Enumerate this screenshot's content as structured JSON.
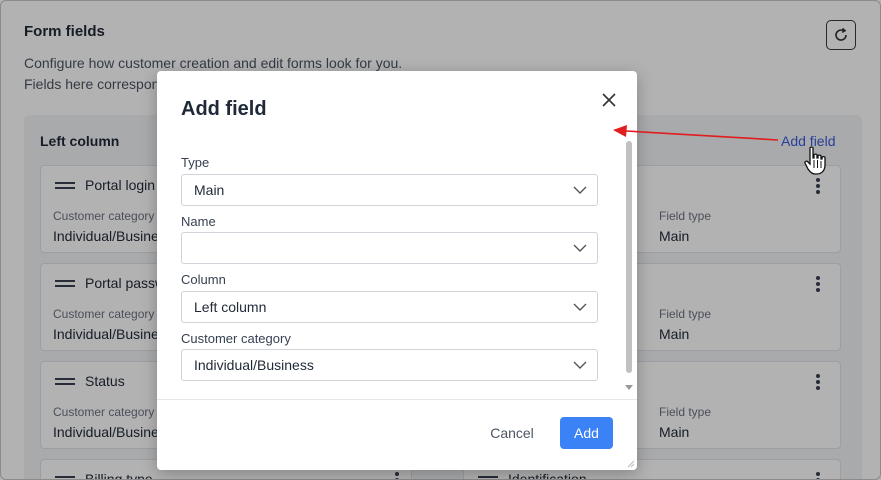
{
  "page": {
    "title": "Form fields",
    "description_line1": "Configure how customer creation and edit forms look for you.",
    "description_line2": "Fields here correspond to the customer fields in your customer profile."
  },
  "left_column": {
    "title": "Left column",
    "cards": [
      {
        "title": "Portal login",
        "category_label": "Customer category",
        "category_value": "Individual/Business"
      },
      {
        "title": "Portal password",
        "category_label": "Customer category",
        "category_value": "Individual/Business"
      },
      {
        "title": "Status",
        "category_label": "Customer category",
        "category_value": "Individual/Business"
      },
      {
        "title": "Billing type"
      }
    ]
  },
  "right_column": {
    "add_field_label": "Add field",
    "cards": [
      {
        "field_type_label": "Field type",
        "field_type_value": "Main"
      },
      {
        "field_type_label": "Field type",
        "field_type_value": "Main"
      },
      {
        "field_type_label": "Field type",
        "field_type_value": "Main"
      },
      {
        "title": "Identification"
      }
    ]
  },
  "modal": {
    "title": "Add field",
    "fields": [
      {
        "label": "Type",
        "value": "Main"
      },
      {
        "label": "Name",
        "value": ""
      },
      {
        "label": "Column",
        "value": "Left column"
      },
      {
        "label": "Customer category",
        "value": "Individual/Business"
      }
    ],
    "cancel_label": "Cancel",
    "add_label": "Add"
  },
  "icons": {
    "refresh": "refresh-icon",
    "close": "close-icon",
    "chevron": "chevron-down-icon",
    "drag": "drag-handle-icon",
    "kebab": "kebab-menu-icon",
    "cursor": "hand-pointer-icon"
  },
  "colors": {
    "accent": "#3b82f6",
    "link": "#3b5bdb",
    "annotation_arrow": "#e11d1d"
  }
}
